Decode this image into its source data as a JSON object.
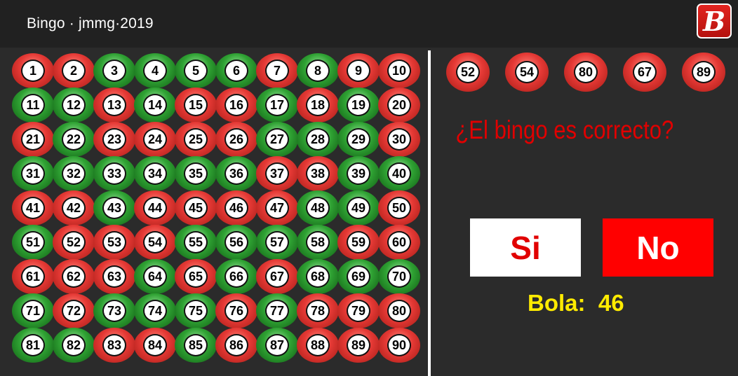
{
  "app": {
    "title": "Bingo   ·   jmmg·2019",
    "logo_letter": "B"
  },
  "board": {
    "balls": [
      {
        "n": "1",
        "color": "red"
      },
      {
        "n": "2",
        "color": "red"
      },
      {
        "n": "3",
        "color": "green"
      },
      {
        "n": "4",
        "color": "green"
      },
      {
        "n": "5",
        "color": "green"
      },
      {
        "n": "6",
        "color": "green"
      },
      {
        "n": "7",
        "color": "red"
      },
      {
        "n": "8",
        "color": "green"
      },
      {
        "n": "9",
        "color": "red"
      },
      {
        "n": "10",
        "color": "red"
      },
      {
        "n": "11",
        "color": "green"
      },
      {
        "n": "12",
        "color": "green"
      },
      {
        "n": "13",
        "color": "red"
      },
      {
        "n": "14",
        "color": "green"
      },
      {
        "n": "15",
        "color": "red"
      },
      {
        "n": "16",
        "color": "red"
      },
      {
        "n": "17",
        "color": "green"
      },
      {
        "n": "18",
        "color": "red"
      },
      {
        "n": "19",
        "color": "green"
      },
      {
        "n": "20",
        "color": "red"
      },
      {
        "n": "21",
        "color": "red"
      },
      {
        "n": "22",
        "color": "green"
      },
      {
        "n": "23",
        "color": "red"
      },
      {
        "n": "24",
        "color": "red"
      },
      {
        "n": "25",
        "color": "red"
      },
      {
        "n": "26",
        "color": "red"
      },
      {
        "n": "27",
        "color": "green"
      },
      {
        "n": "28",
        "color": "green"
      },
      {
        "n": "29",
        "color": "green"
      },
      {
        "n": "30",
        "color": "red"
      },
      {
        "n": "31",
        "color": "green"
      },
      {
        "n": "32",
        "color": "green"
      },
      {
        "n": "33",
        "color": "green"
      },
      {
        "n": "34",
        "color": "green"
      },
      {
        "n": "35",
        "color": "green"
      },
      {
        "n": "36",
        "color": "green"
      },
      {
        "n": "37",
        "color": "red"
      },
      {
        "n": "38",
        "color": "red"
      },
      {
        "n": "39",
        "color": "green"
      },
      {
        "n": "40",
        "color": "green"
      },
      {
        "n": "41",
        "color": "red"
      },
      {
        "n": "42",
        "color": "red"
      },
      {
        "n": "43",
        "color": "green"
      },
      {
        "n": "44",
        "color": "red"
      },
      {
        "n": "45",
        "color": "red"
      },
      {
        "n": "46",
        "color": "red"
      },
      {
        "n": "47",
        "color": "red"
      },
      {
        "n": "48",
        "color": "green"
      },
      {
        "n": "49",
        "color": "green"
      },
      {
        "n": "50",
        "color": "red"
      },
      {
        "n": "51",
        "color": "green"
      },
      {
        "n": "52",
        "color": "red"
      },
      {
        "n": "53",
        "color": "red"
      },
      {
        "n": "54",
        "color": "red"
      },
      {
        "n": "55",
        "color": "green"
      },
      {
        "n": "56",
        "color": "green"
      },
      {
        "n": "57",
        "color": "green"
      },
      {
        "n": "58",
        "color": "green"
      },
      {
        "n": "59",
        "color": "red"
      },
      {
        "n": "60",
        "color": "red"
      },
      {
        "n": "61",
        "color": "red"
      },
      {
        "n": "62",
        "color": "red"
      },
      {
        "n": "63",
        "color": "red"
      },
      {
        "n": "64",
        "color": "green"
      },
      {
        "n": "65",
        "color": "red"
      },
      {
        "n": "66",
        "color": "green"
      },
      {
        "n": "67",
        "color": "red"
      },
      {
        "n": "68",
        "color": "green"
      },
      {
        "n": "69",
        "color": "green"
      },
      {
        "n": "70",
        "color": "green"
      },
      {
        "n": "71",
        "color": "green"
      },
      {
        "n": "72",
        "color": "red"
      },
      {
        "n": "73",
        "color": "green"
      },
      {
        "n": "74",
        "color": "green"
      },
      {
        "n": "75",
        "color": "green"
      },
      {
        "n": "76",
        "color": "red"
      },
      {
        "n": "77",
        "color": "green"
      },
      {
        "n": "78",
        "color": "red"
      },
      {
        "n": "79",
        "color": "red"
      },
      {
        "n": "80",
        "color": "red"
      },
      {
        "n": "81",
        "color": "green"
      },
      {
        "n": "82",
        "color": "green"
      },
      {
        "n": "83",
        "color": "red"
      },
      {
        "n": "84",
        "color": "red"
      },
      {
        "n": "85",
        "color": "green"
      },
      {
        "n": "86",
        "color": "red"
      },
      {
        "n": "87",
        "color": "green"
      },
      {
        "n": "88",
        "color": "red"
      },
      {
        "n": "89",
        "color": "red"
      },
      {
        "n": "90",
        "color": "red"
      }
    ]
  },
  "recent_balls": [
    {
      "n": "52",
      "color": "red"
    },
    {
      "n": "54",
      "color": "red"
    },
    {
      "n": "80",
      "color": "red"
    },
    {
      "n": "67",
      "color": "red"
    },
    {
      "n": "89",
      "color": "red"
    }
  ],
  "question": "¿El bingo es correcto?",
  "buttons": {
    "yes_label": "Si",
    "no_label": "No"
  },
  "status": {
    "bola_label": "Bola:",
    "bola_value": "46"
  },
  "colors": {
    "red": "#e53935",
    "green": "#2fa233",
    "question": "#e10000",
    "bola": "#ffeb00"
  }
}
